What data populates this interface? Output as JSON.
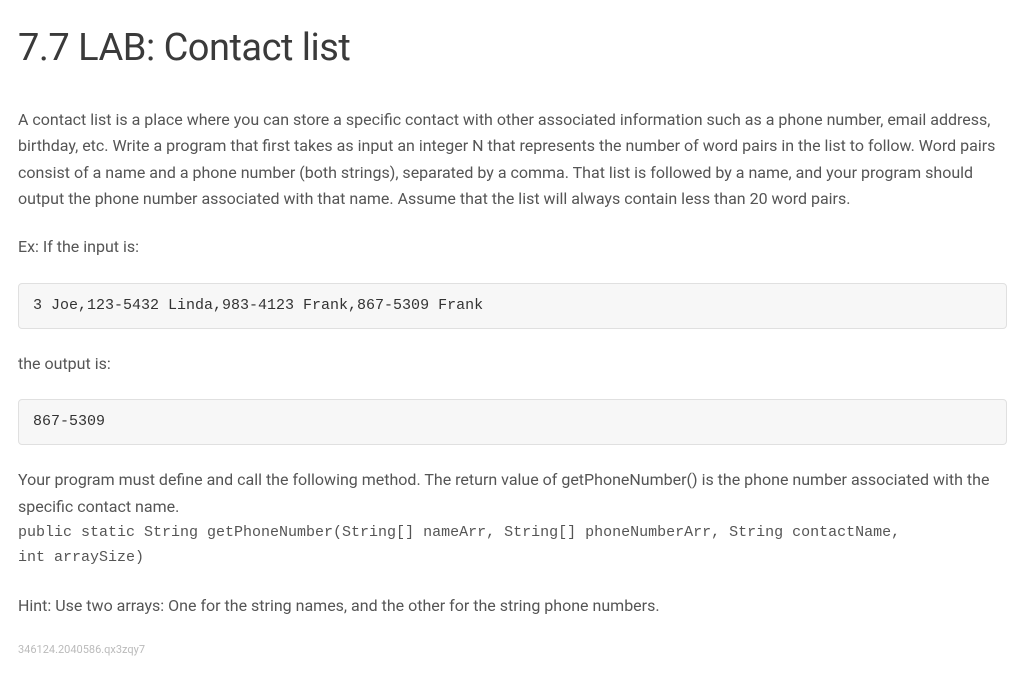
{
  "title": "7.7 LAB: Contact list",
  "intro": "A contact list is a place where you can store a specific contact with other associated information such as a phone number, email address, birthday, etc. Write a program that first takes as input an integer N that represents the number of word pairs in the list to follow. Word pairs consist of a name and a phone number (both strings), separated by a comma. That list is followed by a name, and your program should output the phone number associated with that name. Assume that the list will always contain less than 20 word pairs.",
  "example_label": "Ex: If the input is:",
  "example_input": "3 Joe,123-5432 Linda,983-4123 Frank,867-5309 Frank",
  "output_label": "the output is:",
  "example_output": "867-5309",
  "method_desc": "Your program must define and call the following method. The return value of getPhoneNumber() is the phone number associated with the specific contact name.",
  "method_sig_1": "public static String getPhoneNumber(String[] nameArr, String[] phoneNumberArr, String contactName,",
  "method_sig_2": "int arraySize)",
  "hint": "Hint: Use two arrays: One for the string names, and the other for the string phone numbers.",
  "footer": "346124.2040586.qx3zqy7"
}
